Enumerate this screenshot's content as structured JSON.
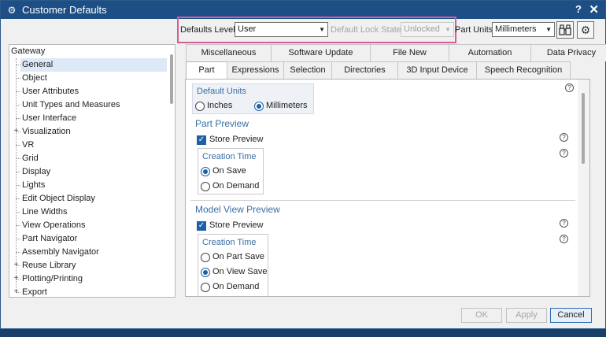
{
  "window": {
    "title": "Customer Defaults",
    "help": "?",
    "close": "✕"
  },
  "toolbar": {
    "defaults_level_label": "Defaults Level",
    "defaults_level_value": "User",
    "lock_state_label": "Default Lock State",
    "lock_state_value": "Unlocked",
    "part_units_label": "Part Units",
    "part_units_value": "Millimeters",
    "highlight_color": "#d85c9a"
  },
  "tree": {
    "root": "Gateway",
    "items": [
      {
        "label": "General",
        "selected": true,
        "expandable": false
      },
      {
        "label": "Object",
        "expandable": false
      },
      {
        "label": "User Attributes",
        "expandable": false
      },
      {
        "label": "Unit Types and Measures",
        "expandable": false
      },
      {
        "label": "User Interface",
        "expandable": false
      },
      {
        "label": "Visualization",
        "expandable": true
      },
      {
        "label": "VR",
        "expandable": false
      },
      {
        "label": "Grid",
        "expandable": false
      },
      {
        "label": "Display",
        "expandable": false
      },
      {
        "label": "Lights",
        "expandable": false
      },
      {
        "label": "Edit Object Display",
        "expandable": false
      },
      {
        "label": "Line Widths",
        "expandable": false
      },
      {
        "label": "View Operations",
        "expandable": false
      },
      {
        "label": "Part Navigator",
        "expandable": false
      },
      {
        "label": "Assembly Navigator",
        "expandable": false
      },
      {
        "label": "Reuse Library",
        "expandable": true
      },
      {
        "label": "Plotting/Printing",
        "expandable": true
      },
      {
        "label": "Export",
        "expandable": true
      }
    ]
  },
  "tabs": {
    "row1": [
      "Miscellaneous",
      "Software Update",
      "File New",
      "Automation",
      "Data Privacy"
    ],
    "row2": [
      "Part",
      "Expressions",
      "Selection",
      "Directories",
      "3D Input Device",
      "Speech Recognition"
    ],
    "active": "Part"
  },
  "panel": {
    "default_units": {
      "title": "Default Units",
      "options": [
        "Inches",
        "Millimeters"
      ],
      "selected": "Millimeters"
    },
    "part_preview": {
      "title": "Part Preview",
      "store_preview": "Store Preview",
      "creation_time_title": "Creation Time",
      "options": [
        "On Save",
        "On Demand"
      ],
      "selected": "On Save"
    },
    "model_view_preview": {
      "title": "Model View Preview",
      "store_preview": "Store Preview",
      "creation_time_title": "Creation Time",
      "options": [
        "On Part Save",
        "On View Save",
        "On Demand"
      ],
      "selected": "On View Save"
    }
  },
  "buttons": {
    "ok": "OK",
    "apply": "Apply",
    "cancel": "Cancel"
  },
  "colors": {
    "titlebar": "#1d4f86",
    "accent": "#1f5fa8",
    "section_text": "#3b6ea5"
  }
}
